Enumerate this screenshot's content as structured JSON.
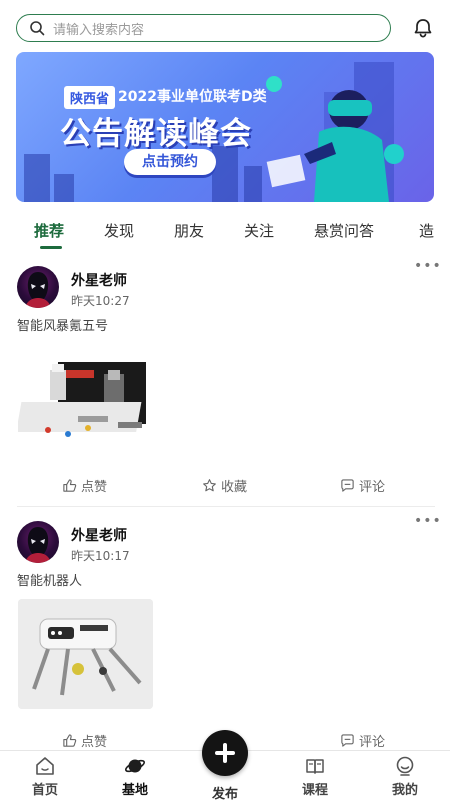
{
  "search": {
    "placeholder": "请输入搜索内容"
  },
  "banner": {
    "province": "陕西省",
    "subtitle": "2022事业单位联考D类",
    "headline": "公告解读峰会",
    "button": "点击预约"
  },
  "tabs": [
    "推荐",
    "发现",
    "朋友",
    "关注",
    "悬赏问答",
    "造"
  ],
  "active_tab": "推荐",
  "posts": [
    {
      "author": "外星老师",
      "time": "昨天10:27",
      "text": "智能风暴氪五号",
      "actions": {
        "like": "点赞",
        "favorite": "收藏",
        "comment": "评论"
      }
    },
    {
      "author": "外星老师",
      "time": "昨天10:17",
      "text": "智能机器人",
      "actions": {
        "like": "点赞",
        "comment": "评论"
      }
    }
  ],
  "nav": {
    "home": "首页",
    "base": "基地",
    "publish": "发布",
    "course": "课程",
    "mine": "我的"
  },
  "colors": {
    "accent": "#1d6b3d",
    "banner": "#5b84f4"
  }
}
